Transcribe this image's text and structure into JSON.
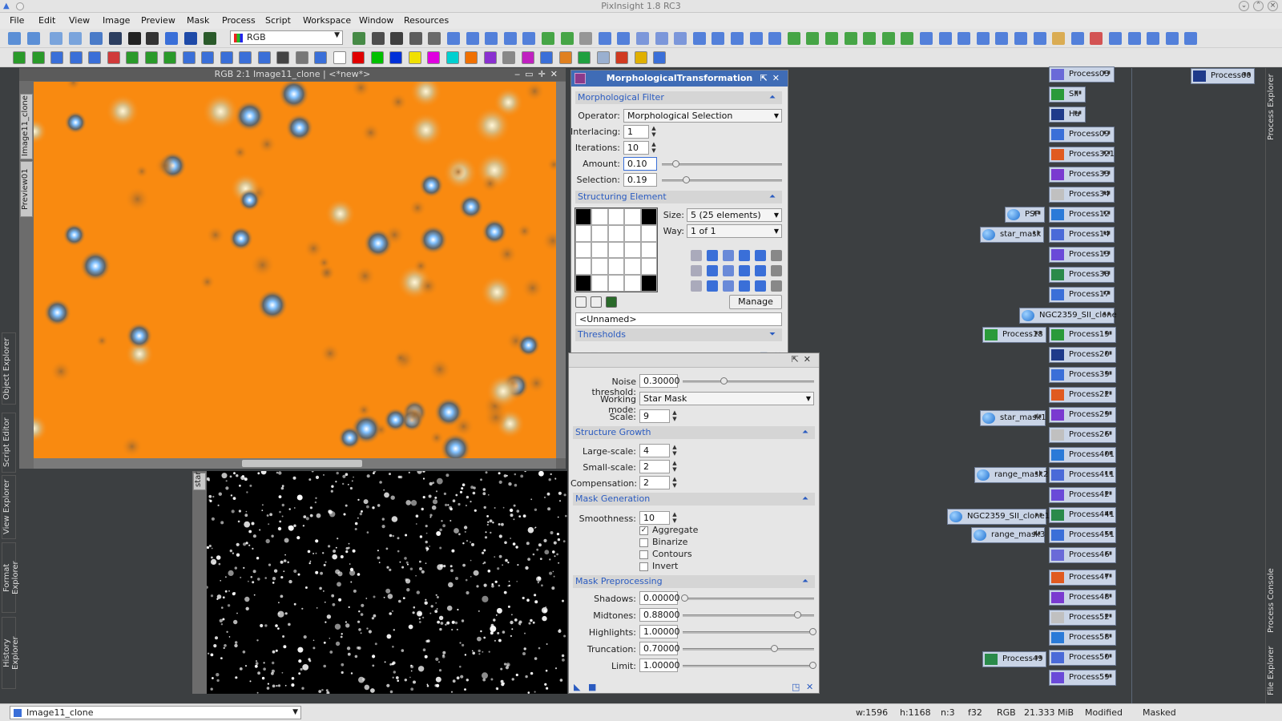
{
  "window": {
    "title": "PixInsight 1.8 RC3"
  },
  "menu": [
    "File",
    "Edit",
    "View",
    "Image",
    "Preview",
    "Mask",
    "Process",
    "Script",
    "Workspace",
    "Window",
    "Resources"
  ],
  "toolbar": {
    "color_space": "RGB"
  },
  "left_dock": {
    "tabs": [
      "Object Explorer",
      "Script Editor",
      "View Explorer",
      "Format Explorer",
      "History Explorer"
    ]
  },
  "image_window": {
    "title": "RGB 2:1 Image11_clone | <*new*>",
    "side_tabs": [
      "Image11_clone",
      "Preview01"
    ],
    "star_label": "star"
  },
  "morph": {
    "title": "MorphologicalTransformation",
    "filter_section": "Morphological Filter",
    "operator_label": "Operator:",
    "operator_value": "Morphological Selection",
    "interlacing_label": "Interlacing:",
    "interlacing_value": "1",
    "iterations_label": "Iterations:",
    "iterations_value": "10",
    "amount_label": "Amount:",
    "amount_value": "0.10",
    "amount_level": 0.1,
    "selection_label": "Selection:",
    "selection_value": "0.19",
    "selection_level": 0.19,
    "structuring_section": "Structuring Element",
    "size_label": "Size:",
    "size_value": "5  (25 elements)",
    "way_label": "Way:",
    "way_value": "1 of 1",
    "manage_button": "Manage",
    "name_value": "<Unnamed>",
    "thresholds_section": "Thresholds"
  },
  "starmask": {
    "noise_threshold_label": "Noise threshold:",
    "noise_threshold_value": "0.30000",
    "noise_threshold_level": 0.3,
    "working_mode_label": "Working mode:",
    "working_mode_value": "Star Mask",
    "scale_label": "Scale:",
    "scale_value": "9",
    "growth_section": "Structure Growth",
    "large_label": "Large-scale:",
    "large_value": "4",
    "small_label": "Small-scale:",
    "small_value": "2",
    "comp_label": "Compensation:",
    "comp_value": "2",
    "mask_gen_section": "Mask Generation",
    "smooth_label": "Smoothness:",
    "smooth_value": "10",
    "aggregate": "Aggregate",
    "binarize": "Binarize",
    "contours": "Contours",
    "invert": "Invert",
    "prep_section": "Mask Preprocessing",
    "shadows_label": "Shadows:",
    "shadows_value": "0.00000",
    "midtones_label": "Midtones:",
    "midtones_value": "0.88000",
    "highlights_label": "Highlights:",
    "highlights_value": "1.00000",
    "truncation_label": "Truncation:",
    "truncation_value": "0.70000",
    "limit_label": "Limit:",
    "limit_value": "1.00000"
  },
  "workspace_icons": {
    "col_a": [
      "Process03",
      "SII",
      "Ha",
      "Process09",
      "Process321",
      "Process33",
      "Process34",
      "Process12",
      "Process14",
      "Process13",
      "Process38",
      "Process17"
    ],
    "col_b": [
      "Process19",
      "Process20",
      "Process39",
      "Process22",
      "Process29",
      "Process26",
      "Process401",
      "Process411",
      "Process42",
      "Process441",
      "Process451",
      "Process46",
      "Process47",
      "Process48",
      "Process52",
      "Process58",
      "Process50",
      "Process59"
    ],
    "psf": "PSF",
    "star_mask": "star_mask",
    "ngc_clone": "NGC2359_SII_clone",
    "process18": "Process18",
    "star_mask1": "star_mask1",
    "range_mask2": "range_mask2",
    "ngc_clone1": "NGC2359_SII_clone1",
    "range_mask3": "range_mask3",
    "process49": "Process49",
    "process60": "Process60"
  },
  "right_dock": {
    "tabs": [
      "Process Explorer",
      "Process Console",
      "File Explorer"
    ]
  },
  "status": {
    "view": "Image11_clone",
    "width": "w:1596",
    "height": "h:1168",
    "channels": "n:3",
    "format": "f32",
    "color_space": "RGB",
    "size": "21.333 MiB",
    "modified": "Modified",
    "masked": "Masked"
  },
  "colors": {
    "image_bg": "#f98a10",
    "panel_header": "#3f6cb6",
    "section_text": "#2a5bc0",
    "workspace": "#3c3f41"
  }
}
